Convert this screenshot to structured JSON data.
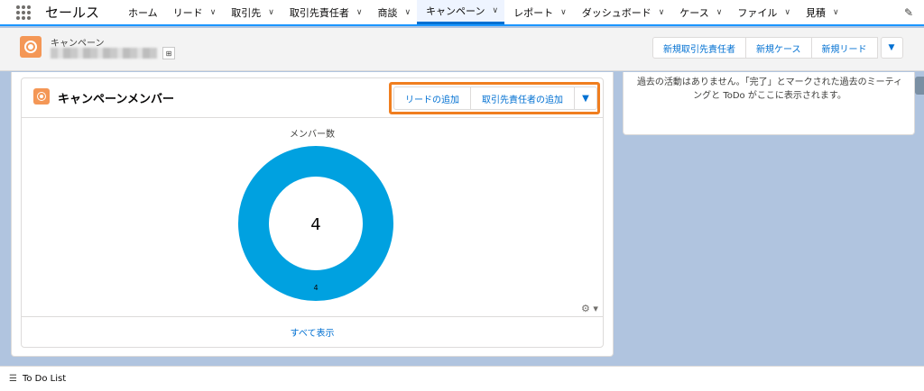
{
  "nav": {
    "app_name": "セールス",
    "items": [
      {
        "label": "ホーム",
        "chevron": false
      },
      {
        "label": "リード",
        "chevron": true
      },
      {
        "label": "取引先",
        "chevron": true
      },
      {
        "label": "取引先責任者",
        "chevron": true
      },
      {
        "label": "商談",
        "chevron": true
      },
      {
        "label": "キャンペーン",
        "chevron": true,
        "active": true
      },
      {
        "label": "レポート",
        "chevron": true
      },
      {
        "label": "ダッシュボード",
        "chevron": true
      },
      {
        "label": "ケース",
        "chevron": true
      },
      {
        "label": "ファイル",
        "chevron": true
      },
      {
        "label": "見積",
        "chevron": true
      }
    ],
    "chevron_glyph": "∨",
    "edit_icon": "✎"
  },
  "record": {
    "object_type": "キャンペーン",
    "hierarchy_icon": "⊞",
    "actions": [
      "新規取引先責任者",
      "新規ケース",
      "新規リード"
    ],
    "more_glyph": "▼"
  },
  "activity": {
    "empty_text": "過去の活動はありません。「完了」とマークされた過去のミーティングと ToDo がここに表示されます。"
  },
  "members_card": {
    "title": "キャンペーンメンバー",
    "actions": [
      "リードの追加",
      "取引先責任者の追加"
    ],
    "more_glyph": "▼",
    "view_all": "すべて表示",
    "gear_glyph": "⚙ ▾",
    "highlight_color": "#f07e1f"
  },
  "chart_data": {
    "type": "pie",
    "title": "メンバー数",
    "center_label": "4",
    "slices": [
      {
        "label": "4",
        "value": 4,
        "color": "#00a1e0"
      }
    ]
  },
  "utility": {
    "todo_label": "To Do List",
    "todo_icon": "☰"
  }
}
